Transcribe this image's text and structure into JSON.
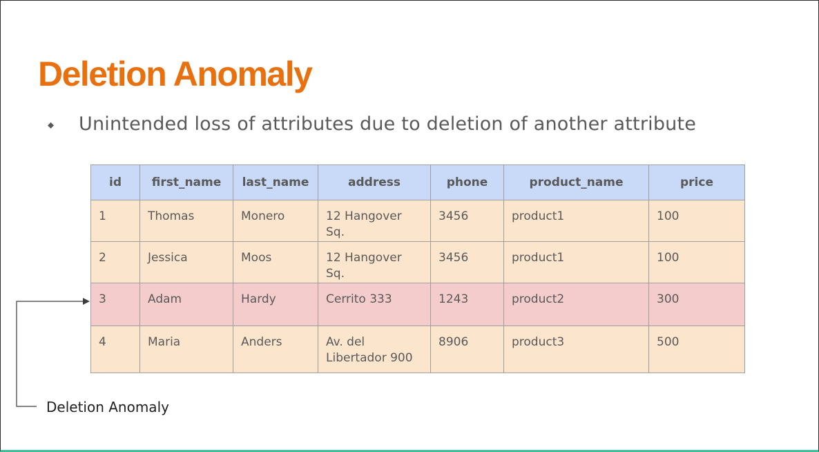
{
  "slide": {
    "title": "Deletion Anomaly",
    "bullet": "Unintended loss of attributes due to deletion of another attribute",
    "colors": {
      "title": "#e8700e",
      "header_fill": "#c9daf8",
      "row_fill": "#fce5cd",
      "deleted_row_fill": "#f4cccc",
      "bottom_accent": "#3fbf9a"
    }
  },
  "table": {
    "columns": [
      "id",
      "first_name",
      "last_name",
      "address",
      "phone",
      "product_name",
      "price"
    ],
    "rows": [
      {
        "id": "1",
        "first_name": "Thomas",
        "last_name": "Monero",
        "address": "12 Hangover Sq.",
        "phone": "3456",
        "product_name": "product1",
        "price": "100"
      },
      {
        "id": "2",
        "first_name": "Jessica",
        "last_name": "Moos",
        "address": "12 Hangover Sq.",
        "phone": "3456",
        "product_name": "product1",
        "price": "100"
      },
      {
        "id": "3",
        "first_name": "Adam",
        "last_name": "Hardy",
        "address": "Cerrito 333",
        "phone": "1243",
        "product_name": "product2",
        "price": "300"
      },
      {
        "id": "4",
        "first_name": "Maria",
        "last_name": "Anders",
        "address": "Av. del Libertador 900",
        "phone": "8906",
        "product_name": "product3",
        "price": "500"
      }
    ]
  },
  "callout": {
    "label": "Deletion Anomaly",
    "target_row": "3",
    "icon": "arrow-right-icon"
  }
}
